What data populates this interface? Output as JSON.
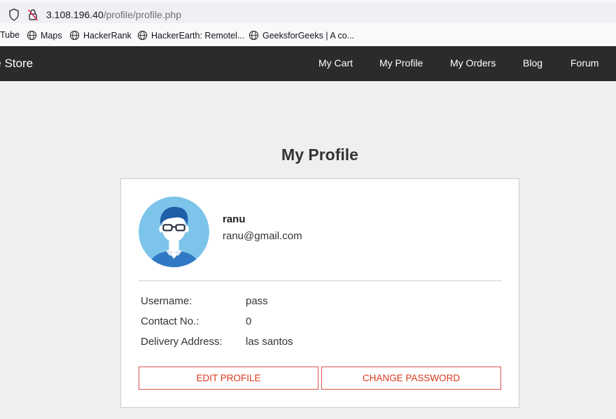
{
  "browser": {
    "url_host": "3.108.196.40",
    "url_path": "/profile/profile.php",
    "bookmarks": [
      "Tube",
      "Maps",
      "HackerRank",
      "HackerEarth: Remotel...",
      "GeeksforGeeks | A co..."
    ]
  },
  "navbar": {
    "brand": "yle Store",
    "links": [
      "My Cart",
      "My Profile",
      "My Orders",
      "Blog",
      "Forum"
    ]
  },
  "page": {
    "title": "My Profile"
  },
  "profile": {
    "name": "ranu",
    "email": "ranu@gmail.com",
    "fields": [
      {
        "label": "Username:",
        "value": "pass"
      },
      {
        "label": "Contact No.:",
        "value": "0"
      },
      {
        "label": "Delivery Address:",
        "value": "las santos"
      }
    ],
    "edit_label": "EDIT PROFILE",
    "password_label": "CHANGE PASSWORD"
  },
  "colors": {
    "navbar_bg": "#2b2b2b",
    "button_accent": "#d9381e",
    "avatar_bg": "#7cc4ea"
  }
}
